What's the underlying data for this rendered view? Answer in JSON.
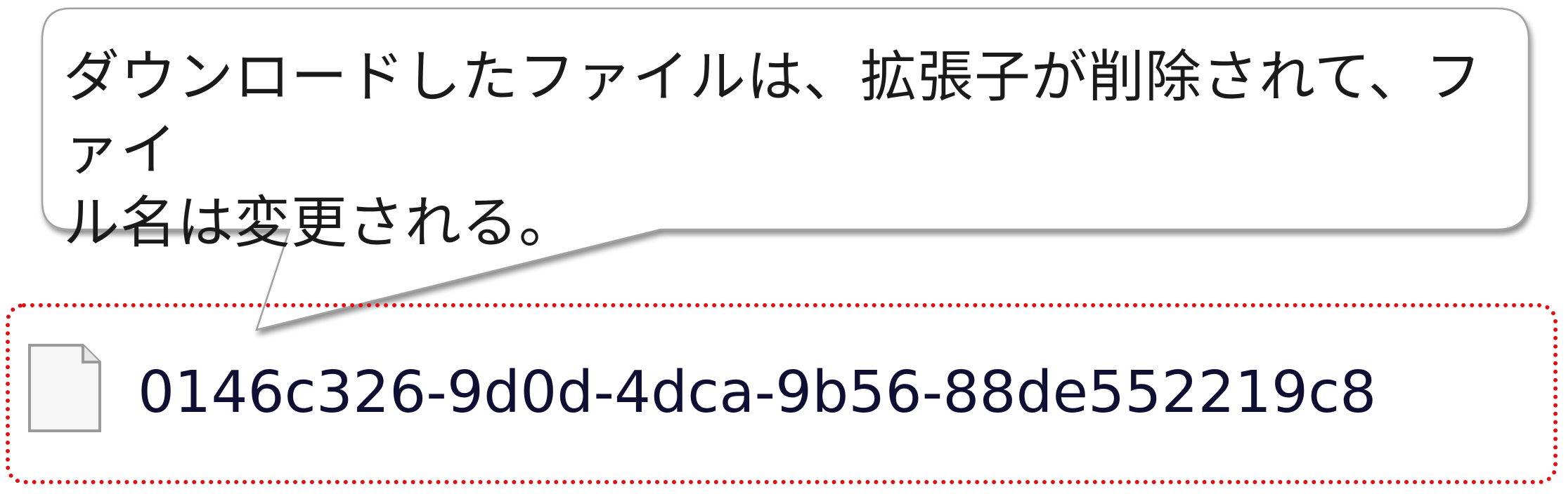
{
  "callout": {
    "text_line1": "ダウンロードしたファイルは、拡張子が削除されて、ファイ",
    "text_line2": "ル名は変更される。"
  },
  "file": {
    "icon": "blank-document-icon",
    "name": "0146c326-9d0d-4dca-9b56-88de552219c8"
  },
  "colors": {
    "highlight_border": "#e01010",
    "bubble_fill": "#ffffff",
    "bubble_stroke": "#a0a0a0",
    "file_name_text": "#0f0f33"
  }
}
